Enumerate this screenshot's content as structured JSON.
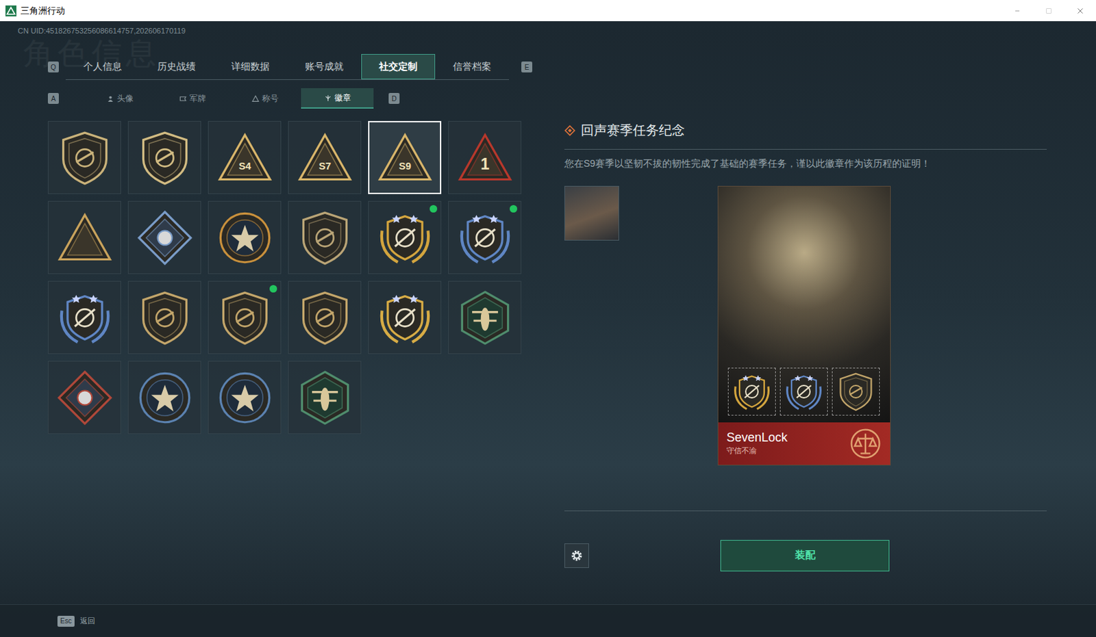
{
  "window": {
    "title": "三角洲行动"
  },
  "uid": "CN UID:451826753256086614757,202606170119",
  "watermark": "角色信息",
  "tabs": {
    "prev_key": "Q",
    "next_key": "E",
    "items": [
      {
        "label": "个人信息",
        "selected": false
      },
      {
        "label": "历史战绩",
        "selected": false
      },
      {
        "label": "详细数据",
        "selected": false
      },
      {
        "label": "账号成就",
        "selected": false
      },
      {
        "label": "社交定制",
        "selected": true
      },
      {
        "label": "信誉档案",
        "selected": false
      }
    ]
  },
  "subtabs": {
    "prev_key": "A",
    "next_key": "D",
    "items": [
      {
        "label": "头像",
        "selected": false
      },
      {
        "label": "军牌",
        "selected": false
      },
      {
        "label": "称号",
        "selected": false
      },
      {
        "label": "徽章",
        "selected": true
      }
    ]
  },
  "badges": [
    {
      "kind": "shield",
      "color": "#c9b27a",
      "selected": false,
      "new": false
    },
    {
      "kind": "shield",
      "color": "#d1bb82",
      "selected": false,
      "new": false
    },
    {
      "kind": "triangle",
      "color": "#d8b56a",
      "label": "S4",
      "selected": false,
      "new": false
    },
    {
      "kind": "triangle",
      "color": "#d8b56a",
      "label": "S7",
      "selected": false,
      "new": false
    },
    {
      "kind": "triangle",
      "color": "#d8b56a",
      "label": "S9",
      "selected": true,
      "new": false
    },
    {
      "kind": "triangle",
      "color": "#b8382c",
      "label": "1",
      "selected": false,
      "new": false
    },
    {
      "kind": "triangle",
      "color": "#c9a35c",
      "selected": false,
      "new": false
    },
    {
      "kind": "diamond",
      "color": "#7a9cc8",
      "selected": false,
      "new": false
    },
    {
      "kind": "circle",
      "color": "#c8903c",
      "selected": false,
      "new": false
    },
    {
      "kind": "shield",
      "color": "#b9a476",
      "selected": false,
      "new": false
    },
    {
      "kind": "wreath",
      "color": "#d3a53e",
      "selected": false,
      "new": true
    },
    {
      "kind": "wreath",
      "color": "#5f86c4",
      "selected": false,
      "new": true
    },
    {
      "kind": "wreath",
      "color": "#5f86c4",
      "selected": false,
      "new": false
    },
    {
      "kind": "shield",
      "color": "#c2a56a",
      "selected": false,
      "new": false
    },
    {
      "kind": "shield",
      "color": "#c2a56a",
      "selected": false,
      "new": true
    },
    {
      "kind": "shield",
      "color": "#c2a56a",
      "selected": false,
      "new": false
    },
    {
      "kind": "wreath",
      "color": "#d7ac45",
      "selected": false,
      "new": false
    },
    {
      "kind": "hexagon",
      "color": "#4f8c6c",
      "selected": false,
      "new": false
    },
    {
      "kind": "diamond",
      "color": "#b0483a",
      "selected": false,
      "new": false
    },
    {
      "kind": "circle",
      "color": "#5b82b0",
      "selected": false,
      "new": false
    },
    {
      "kind": "circle",
      "color": "#5b82b0",
      "selected": false,
      "new": false
    },
    {
      "kind": "hexagon",
      "color": "#4f8c6c",
      "selected": false,
      "new": false
    }
  ],
  "detail": {
    "title": "回声赛季任务纪念",
    "description": "您在S9赛季以坚韧不拔的韧性完成了基础的赛季任务，谨以此徽章作为该历程的证明！"
  },
  "card": {
    "name": "SevenLock",
    "motto": "守信不渝",
    "equipped": [
      {
        "kind": "wreath",
        "color": "#d3a53e"
      },
      {
        "kind": "wreath",
        "color": "#5f86c4"
      },
      {
        "kind": "shield",
        "color": "#c2a56a"
      }
    ]
  },
  "equip_button": "装配",
  "footer": {
    "key": "Esc",
    "label": "返回"
  }
}
